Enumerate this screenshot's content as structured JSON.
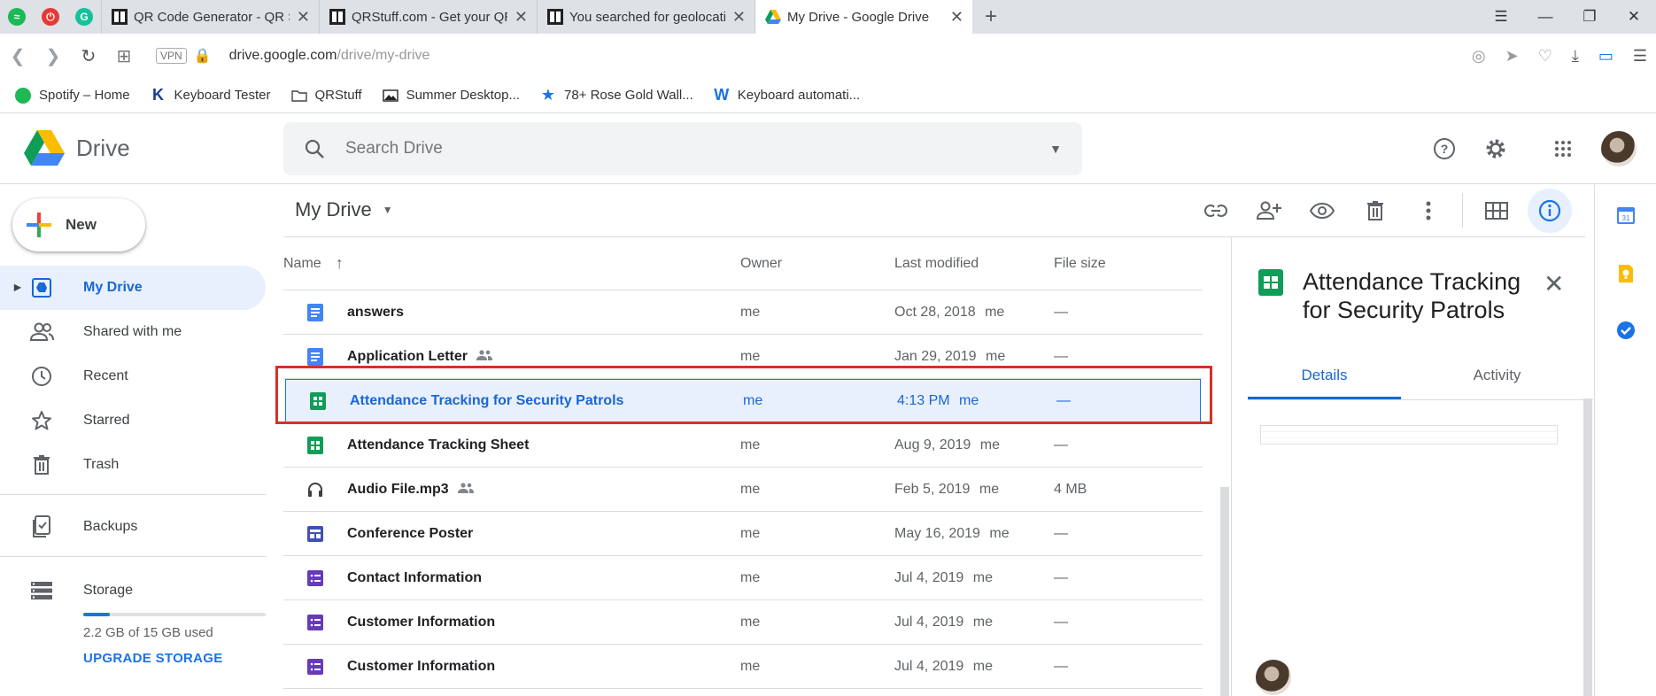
{
  "browser": {
    "tabs": [
      {
        "title": "QR Code Generator - QR Sc",
        "icon": "qr-icon"
      },
      {
        "title": "QRStuff.com - Get your QR",
        "icon": "qr-icon"
      },
      {
        "title": "You searched for geolocatio",
        "icon": "qr-icon"
      },
      {
        "title": "My Drive - Google Drive",
        "icon": "drive-icon"
      }
    ],
    "url_host": "drive.google.com",
    "url_path": "/drive/my-drive",
    "vpn_label": "VPN",
    "bookmarks": [
      {
        "label": "Spotify – Home",
        "icon": "spotify-icon"
      },
      {
        "label": "Keyboard Tester",
        "icon": "k-icon"
      },
      {
        "label": "QRStuff",
        "icon": "folder-icon"
      },
      {
        "label": "Summer Desktop...",
        "icon": "image-icon"
      },
      {
        "label": "78+ Rose Gold Wall...",
        "icon": "star-icon"
      },
      {
        "label": "Keyboard automati...",
        "icon": "w-icon"
      }
    ]
  },
  "header": {
    "app_name": "Drive",
    "search_placeholder": "Search Drive"
  },
  "sidebar": {
    "new_label": "New",
    "items": [
      {
        "label": "My Drive",
        "icon": "my-drive-icon",
        "active": true
      },
      {
        "label": "Shared with me",
        "icon": "people-icon"
      },
      {
        "label": "Recent",
        "icon": "clock-icon"
      },
      {
        "label": "Starred",
        "icon": "star-icon"
      },
      {
        "label": "Trash",
        "icon": "trash-icon"
      },
      {
        "label": "Backups",
        "icon": "backup-icon"
      },
      {
        "label": "Storage",
        "icon": "storage-icon"
      }
    ],
    "storage_used_text": "2.2 GB of 15 GB used",
    "storage_fraction": 0.147,
    "upgrade_label": "UPGRADE STORAGE"
  },
  "main": {
    "breadcrumb": "My Drive",
    "columns": {
      "name": "Name",
      "owner": "Owner",
      "modified": "Last modified",
      "size": "File size"
    },
    "files": [
      {
        "name": "answers",
        "type": "doc",
        "shared": false,
        "owner": "me",
        "modified": "Oct 28, 2018",
        "modified_by": "me",
        "size": "—"
      },
      {
        "name": "Application Letter",
        "type": "doc",
        "shared": true,
        "owner": "me",
        "modified": "Jan 29, 2019",
        "modified_by": "me",
        "size": "—"
      },
      {
        "name": "Attendance Tracking for Security Patrols",
        "type": "sheet",
        "shared": false,
        "owner": "me",
        "modified": "4:13 PM",
        "modified_by": "me",
        "size": "—",
        "selected": true
      },
      {
        "name": "Attendance Tracking Sheet",
        "type": "sheet",
        "shared": false,
        "owner": "me",
        "modified": "Aug 9, 2019",
        "modified_by": "me",
        "size": "—"
      },
      {
        "name": "Audio File.mp3",
        "type": "audio",
        "shared": true,
        "owner": "me",
        "modified": "Feb 5, 2019",
        "modified_by": "me",
        "size": "4 MB"
      },
      {
        "name": "Conference Poster",
        "type": "slides",
        "shared": false,
        "owner": "me",
        "modified": "May 16, 2019",
        "modified_by": "me",
        "size": "—"
      },
      {
        "name": "Contact Information",
        "type": "form",
        "shared": false,
        "owner": "me",
        "modified": "Jul 4, 2019",
        "modified_by": "me",
        "size": "—"
      },
      {
        "name": "Customer Information",
        "type": "form",
        "shared": false,
        "owner": "me",
        "modified": "Jul 4, 2019",
        "modified_by": "me",
        "size": "—"
      },
      {
        "name": "Customer Information",
        "type": "form",
        "shared": false,
        "owner": "me",
        "modified": "Jul 4, 2019",
        "modified_by": "me",
        "size": "—"
      }
    ]
  },
  "details": {
    "title": "Attendance Tracking for Security Patrols",
    "tabs": [
      "Details",
      "Activity"
    ],
    "active_tab": "Details"
  },
  "colors": {
    "accent": "#1a73e8",
    "selection_bg": "#e8f0fe",
    "sheet_green": "#0f9d58",
    "doc_blue": "#4285f4",
    "form_purple": "#673ab7",
    "highlight_red": "#d93025"
  }
}
